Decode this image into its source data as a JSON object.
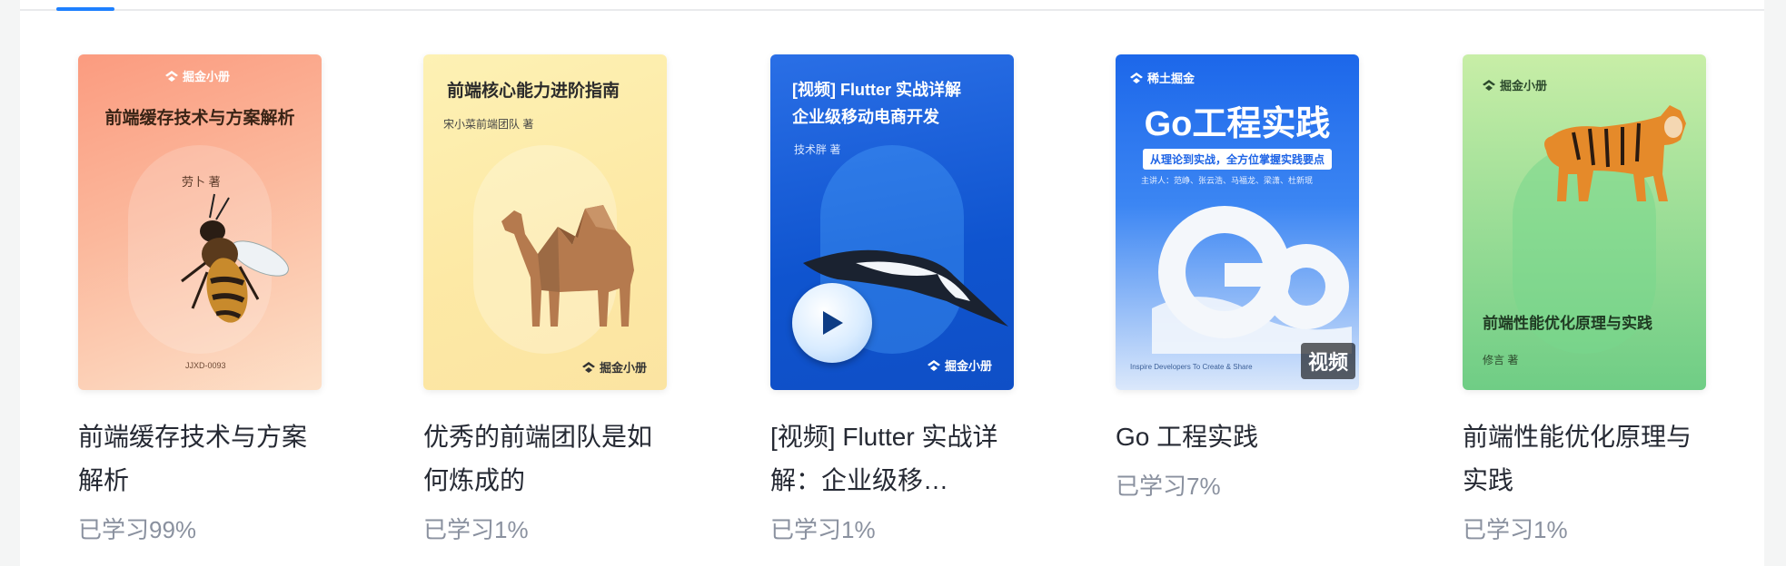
{
  "books": [
    {
      "cover_brand": "掘金小册",
      "cover_title": "前端缓存技术与方案解析",
      "cover_author": "劳卜 著",
      "cover_code": "JJXD-0093",
      "title": "前端缓存技术与方案解析",
      "progress": "已学习99%"
    },
    {
      "cover_brand": "掘金小册",
      "cover_title": "前端核心能力进阶指南",
      "cover_author": "宋小菜前端团队 著",
      "title": "优秀的前端团队是如何炼成的",
      "progress": "已学习1%"
    },
    {
      "cover_brand": "掘金小册",
      "cover_title": "[视频] Flutter 实战详解",
      "cover_subtitle": "企业级移动电商开发",
      "cover_author": "技术胖 著",
      "title": "[视频] Flutter 实战详解：企业级移…",
      "progress": "已学习1%"
    },
    {
      "cover_brand": "稀土掘金",
      "cover_title": "Go工程实践",
      "cover_tagline": "从理论到实战，全方位掌握实践要点",
      "cover_speakers": "主讲人：范峥、张云浩、马福龙、梁潇、杜新珉",
      "cover_slogan": "Inspire Developers To Create & Share",
      "badge": "视频",
      "title": "Go 工程实践",
      "progress": "已学习7%"
    },
    {
      "cover_brand": "掘金小册",
      "cover_title": "前端性能优化原理与实践",
      "cover_author": "修言 著",
      "title": "前端性能优化原理与实践",
      "progress": "已学习1%"
    }
  ]
}
